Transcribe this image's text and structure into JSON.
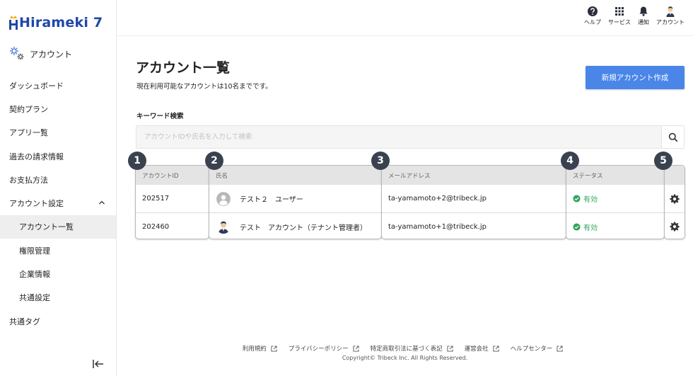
{
  "brand": {
    "logo_text": "Hirameki 7",
    "logo_color": "#1e47a8"
  },
  "sidebar": {
    "section_title": "アカウント",
    "items": [
      {
        "label": "ダッシュボード"
      },
      {
        "label": "契約プラン"
      },
      {
        "label": "アプリ一覧"
      },
      {
        "label": "過去の請求情報"
      },
      {
        "label": "お支払方法"
      },
      {
        "label": "アカウント設定"
      },
      {
        "label": "アカウント一覧"
      },
      {
        "label": "権限管理"
      },
      {
        "label": "企業情報"
      },
      {
        "label": "共通設定"
      },
      {
        "label": "共通タグ"
      }
    ]
  },
  "topbar": {
    "help": "ヘルプ",
    "services": "サービス",
    "notifications": "通知",
    "account": "アカウント"
  },
  "main": {
    "title": "アカウント一覧",
    "subtitle": "現在利用可能なアカウントは10名までです。",
    "create_button": "新規アカウント作成",
    "keyword_label": "キーワード検索",
    "search_placeholder": "アカウントIDや氏名を入力して検索"
  },
  "table": {
    "headers": {
      "id": "アカウントID",
      "name": "氏名",
      "email": "メールアドレス",
      "status": "ステータス"
    },
    "rows": [
      {
        "id": "202517",
        "name": "テスト２　ユーザー",
        "email": "ta-yamamoto+2@tribeck.jp",
        "status": "有効"
      },
      {
        "id": "202460",
        "name": "テスト　アカウント（テナント管理者）",
        "email": "ta-yamamoto+1@tribeck.jp",
        "status": "有効"
      }
    ],
    "status_color": "#2fa45c"
  },
  "badges": [
    "1",
    "2",
    "3",
    "4",
    "5"
  ],
  "footer": {
    "links": [
      "利用規約",
      "プライバシーポリシー",
      "特定商取引法に基づく表記",
      "運営会社",
      "ヘルプセンター"
    ],
    "copyright": "Copyright© Tribeck Inc. All Rights Reserved."
  }
}
